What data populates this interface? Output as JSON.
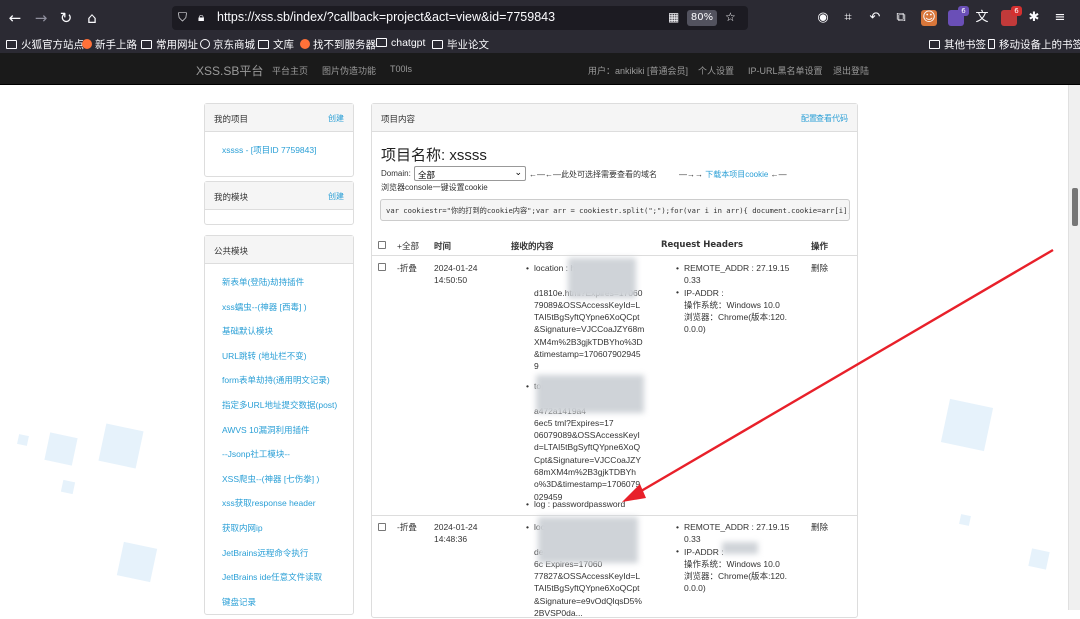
{
  "browser": {
    "url": "https://xss.sb/index/?callback=project&act=view&id=7759843",
    "zoom": "80%",
    "badges": [
      "6",
      "6"
    ],
    "bookmarks": [
      "火狐官方站点",
      "新手上路",
      "常用网址",
      "京东商城",
      "文库",
      "找不到服务器",
      "chatgpt",
      "毕业论文"
    ],
    "bookmarks_right": [
      "其他书签",
      "移动设备上的书签"
    ]
  },
  "site_nav": {
    "brand": "XSS.SB平台",
    "links": [
      "平台主页",
      "图片伪造功能",
      "T00ls"
    ],
    "user": "用户：ankikiki [普通会员]",
    "right_links": [
      "个人设置",
      "IP-URL黑名单设置",
      "退出登陆"
    ]
  },
  "sidebar": {
    "my_projects": {
      "title": "我的项目",
      "action": "创建",
      "item": "xssss - [项目ID 7759843]"
    },
    "my_modules": {
      "title": "我的模块",
      "action": "创建"
    },
    "public_modules": {
      "title": "公共模块",
      "items": [
        "新表单(登陆)劫持插件",
        "xss蠕虫--(神器 [西毒] )",
        "基础默认模块",
        "URL跳转 (地址栏不变)",
        "form表单劫持(通用明文记录)",
        "指定多URL地址提交数据(post)",
        "AWVS 10漏洞利用插件",
        "--Jsonp社工模块--",
        "XSS爬虫--(神器 [七伤拳] )",
        "xss获取response header",
        "获取内网ip",
        "JetBrains远程命令执行",
        "JetBrains ide任意文件读取",
        "键盘记录"
      ]
    }
  },
  "main": {
    "panel_title": "项目内容",
    "actions": [
      "配置",
      "查看代码"
    ],
    "project_name": "项目名称: xssss",
    "domain_label": "Domain:",
    "domain_value": "全部",
    "domain_hint": "←—←—此处可选择需要查看的域名",
    "download_arrow": "—→→",
    "download_link": "下载本项目cookie",
    "download_arrow2": "←—",
    "console_label": "浏览器console一键设置cookie",
    "code": "var cookiestr=\"你的打到的cookie内容\";var arr = cookiestr.split(\";\");for(var i in arr){ document.cookie=arr[i];}",
    "table_headers": [
      "+全部",
      "时间",
      "接收的内容",
      "Request Headers",
      "操作"
    ],
    "rows": [
      {
        "toggle": "-折叠",
        "date": "2024-01-24",
        "time": "14:50:50",
        "content_a": [
          "location : h",
          "",
          "d1810e.html?Expires=17060",
          "79089&OSSAccessKeyId=L",
          "TAI5tBgSyftQYpne6XoQCpt",
          "&Signature=VJCCoaJZY68m",
          "XM4m%2B3gjkTDBYho%3D",
          "&timestamp=170607902945",
          "9"
        ],
        "content_b": [
          "toplocation : h",
          "",
          "a472a1419a4",
          "6ec5    tml?Expires=17",
          "06079089&OSSAccessKeyI",
          "d=LTAI5tBgSyftQYpne6XoQ",
          "Cpt&Signature=VJCCoaJZY",
          "68mXM4m%2B3gjkTDBYh",
          "o%3D&timestamp=1706079",
          "029459"
        ],
        "log": "log : passwordpassword",
        "headers": [
          "REMOTE_ADDR : 27.19.15",
          "0.33",
          "IP-ADDR :",
          "操作系统：Windows 10.0",
          "浏览器：Chrome(版本:120.",
          "0.0.0)"
        ],
        "op": "删除"
      },
      {
        "toggle": "-折叠",
        "date": "2024-01-24",
        "time": "14:48:36",
        "content_a": [
          "location : h",
          "",
          "de4d3ab5db04",
          "6c    Expires=17060",
          "77827&OSSAccessKeyId=L",
          "TAI5tBgSyftQYpne6XoQCpt",
          "&Signature=e9vOdQlqsD5%",
          "2BVSP0da..."
        ],
        "headers": [
          "REMOTE_ADDR : 27.19.15",
          "0.33",
          "IP-ADDR :",
          "操作系统：Windows 10.0",
          "浏览器：Chrome(版本:120.",
          "0.0.0)"
        ],
        "op": "删除"
      }
    ]
  },
  "colors": {
    "link": "#2a9fd6",
    "nav_bg": "#1a1a1a",
    "browser_bg": "#2b2a33",
    "annotation": "#e8202a"
  }
}
